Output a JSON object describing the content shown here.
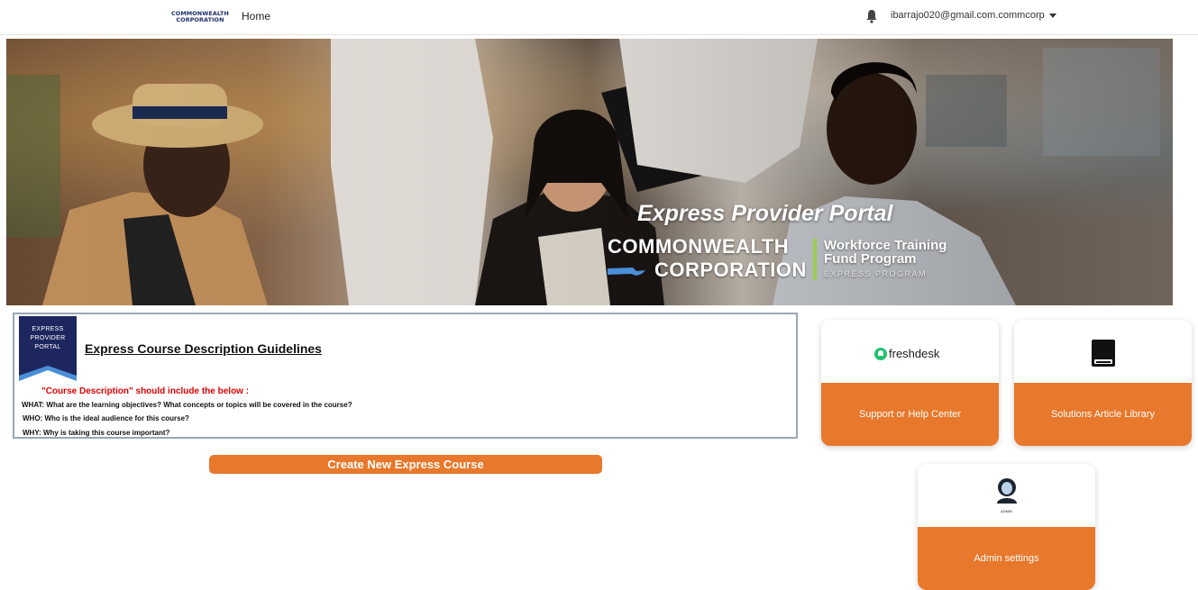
{
  "nav": {
    "logo_line1": "COMMONWEALTH",
    "logo_line2": "CORPORATION",
    "home_label": "Home",
    "user_email": "ibarrajo020@gmail.com.commcorp"
  },
  "hero": {
    "portal_title": "Express Provider Portal",
    "org_line1": "COMMONWEALTH",
    "org_line2": "CORPORATION",
    "program_line1": "Workforce Training",
    "program_line2": "Fund Program",
    "program_sub": "EXPRESS PROGRAM"
  },
  "guidelines": {
    "badge_line1": "EXPRESS",
    "badge_line2": "PROVIDER",
    "badge_line3": "PORTAL",
    "title": "Express Course Description Guidelines",
    "intro": "\"Course Description\" should include the below :",
    "what": "WHAT: What are the learning objectives? What concepts or topics will be covered in the course?",
    "who": "WHO: Who is the ideal audience for this course?",
    "why": "WHY: Why is taking this course important?"
  },
  "create_button_label": "Create New Express Course",
  "cards": {
    "support": {
      "logo_text": "freshdesk",
      "label": "Support or Help Center"
    },
    "solutions": {
      "label": "Solutions Article Library"
    },
    "admin": {
      "icon_caption": "ADMIN",
      "label": "Admin settings"
    }
  },
  "colors": {
    "accent_orange": "#e8782b",
    "badge_navy": "#1e2660",
    "badge_ribbon": "#4a8fd8",
    "guideline_red": "#e00000",
    "divider_green": "#9acd4e"
  }
}
